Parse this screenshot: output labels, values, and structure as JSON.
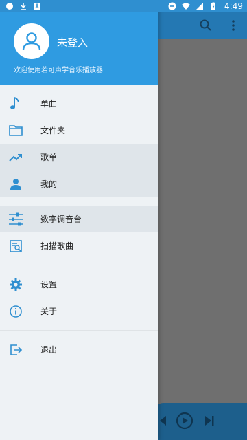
{
  "status_bar": {
    "time": "4:49",
    "left_icons": [
      "circle-icon",
      "download-icon",
      "notification-a-icon"
    ],
    "right_icons": [
      "minus-circle-icon",
      "wifi-icon",
      "signal-icon",
      "battery-icon"
    ]
  },
  "drawer": {
    "header": {
      "username": "未登入",
      "welcome_text": "欢迎使用若可声学音乐播放器",
      "avatar_icon": "user-icon"
    },
    "groups": [
      {
        "items": [
          {
            "name": "songs",
            "label": "单曲",
            "icon": "music-note-icon",
            "selected": false
          },
          {
            "name": "folders",
            "label": "文件夹",
            "icon": "folder-icon",
            "selected": false
          },
          {
            "name": "playlists",
            "label": "歌单",
            "icon": "trending-icon",
            "selected": true
          },
          {
            "name": "mine",
            "label": "我的",
            "icon": "person-icon",
            "selected": true
          }
        ]
      },
      {
        "items": [
          {
            "name": "equalizer",
            "label": "数字调音台",
            "icon": "equalizer-icon",
            "selected": true
          },
          {
            "name": "scan",
            "label": "扫描歌曲",
            "icon": "scan-icon",
            "selected": false
          }
        ]
      },
      {
        "items": [
          {
            "name": "settings",
            "label": "设置",
            "icon": "gear-icon",
            "selected": false
          },
          {
            "name": "about",
            "label": "关于",
            "icon": "info-icon",
            "selected": false
          }
        ]
      },
      {
        "items": [
          {
            "name": "exit",
            "label": "退出",
            "icon": "exit-icon",
            "selected": false
          }
        ]
      }
    ]
  },
  "background_app": {
    "toolbar_icons": [
      "search-icon",
      "more-vert-icon"
    ],
    "player_icons": [
      "prev-icon",
      "play-icon",
      "next-icon"
    ]
  },
  "colors": {
    "accent": "#2f9be1",
    "icon_blue": "#2f8fd0",
    "toolbar_dark": "#2478b3",
    "selected_bg": "#dfe5ea"
  }
}
